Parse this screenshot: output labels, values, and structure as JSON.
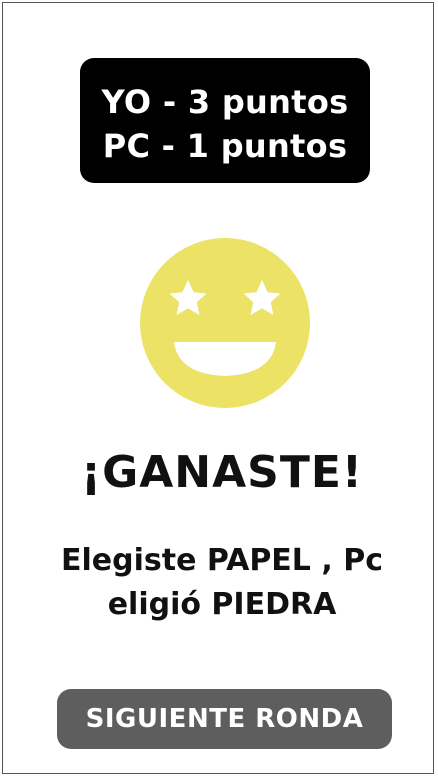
{
  "scoreboard": {
    "player_line": "YO - 3 puntos",
    "pc_line": "PC - 1 puntos"
  },
  "result": {
    "icon": "star-struck-face-icon",
    "title": "¡GANASTE!",
    "detail": "Elegiste PAPEL , Pc eligió PIEDRA"
  },
  "actions": {
    "next_round_label": "SIGUIENTE RONDA"
  },
  "colors": {
    "background": "#ffffff",
    "score_box": "#000000",
    "emoji_face": "#ece265",
    "button": "#5e5e5e",
    "button_text": "#ffffff"
  }
}
